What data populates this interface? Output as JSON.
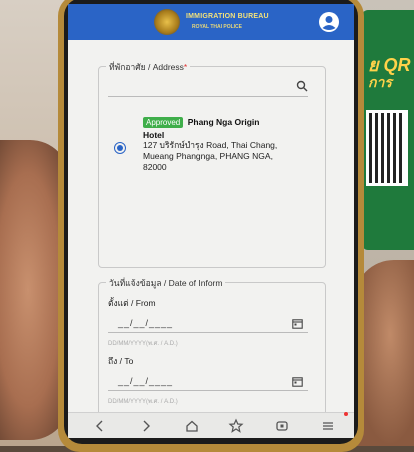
{
  "header": {
    "brand_title": "IMMIGRATION BUREAU",
    "brand_subtitle": "ROYAL THAI POLICE"
  },
  "address_section": {
    "legend": "ที่พักอาศัย / Address",
    "required_mark": "*",
    "selected": {
      "status_badge": "Approved",
      "name_line1": "Phang Nga Origin",
      "name_line2": "Hotel",
      "address_line1": "127 บริรักษ์บำรุง Road, Thai Chang,",
      "address_line2": "Mueang Phangnga, PHANG NGA,",
      "address_line3": "82000"
    }
  },
  "date_section": {
    "legend": "วันที่แจ้งข้อมูล / Date of Inform",
    "from_label": "ตั้งแต่ / From",
    "from_value": "__/__/____",
    "from_hint": "DD/MM/YYYY(พ.ศ. / A.D.)",
    "to_label": "ถึง / To",
    "to_value": "__/__/____",
    "to_hint": "DD/MM/YYYY(พ.ศ. / A.D.)"
  },
  "background": {
    "sign_text": "ย QR",
    "sign_text2": "การ"
  },
  "colors": {
    "header_blue": "#2a64c6",
    "approved_green": "#3fae4a"
  }
}
